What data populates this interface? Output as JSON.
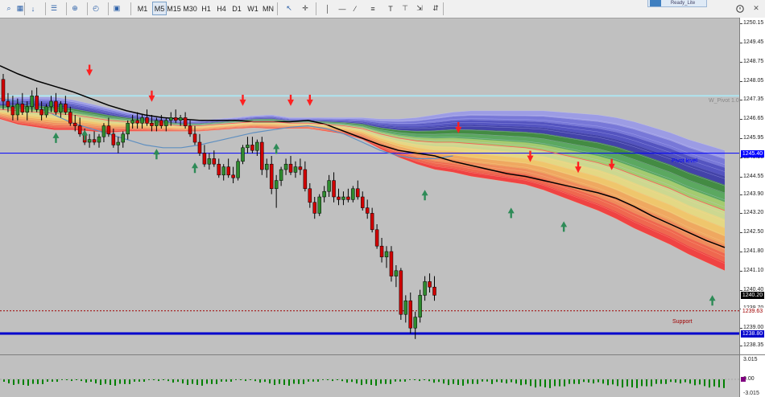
{
  "toolbar": {
    "timeframes": [
      "M1",
      "M5",
      "M15",
      "M30",
      "H1",
      "H4",
      "D1",
      "W1",
      "MN"
    ],
    "active_timeframe": "M5",
    "icons": [
      "zoom-in-icon",
      "crosshair-tools-icon",
      "arrow-down-icon",
      "properties-icon",
      "chart-type-icon",
      "add-indicator-icon",
      "clock-icon",
      "templates-icon",
      "cursor-icon",
      "crosshair-icon",
      "vertical-line-icon",
      "horizontal-line-icon",
      "trend-line-icon",
      "fibonacci-icon",
      "text-icon",
      "label-icon",
      "arrows-icon"
    ],
    "badge_text": "Ready_Lite",
    "help_icon": "help-icon"
  },
  "price_axis": {
    "ticks": [
      "1250.15",
      "1249.45",
      "1248.75",
      "1248.05",
      "1247.35",
      "1246.65",
      "1245.95",
      "1245.25",
      "1244.55",
      "1243.90",
      "1243.20",
      "1242.50",
      "1241.80",
      "1241.10",
      "1240.40",
      "1239.70",
      "1239.00",
      "1238.35"
    ],
    "current_price": "1240.20",
    "tags": [
      {
        "label": "1245.40",
        "color": "#0000ff",
        "text_color": "#ffffff"
      },
      {
        "label": "1240.20",
        "color": "#000000",
        "text_color": "#ffffff"
      },
      {
        "label": "1239.63",
        "color": "#ffffff",
        "text_color": "#a00000"
      },
      {
        "label": "1238.80",
        "color": "#0000cc",
        "text_color": "#ffffff"
      }
    ]
  },
  "levels": {
    "weekly_pivot": {
      "label": "W_Pivot 1.0",
      "price": 1247.5,
      "color": "#aee4f0"
    },
    "pivot": {
      "label": "Pivot level",
      "price": 1245.4,
      "color": "#0000ff"
    },
    "support": {
      "label": "Support",
      "price": 1239.63,
      "color": "#a00000"
    },
    "support2": {
      "price": 1238.8,
      "color": "#0000cc"
    }
  },
  "oscillator": {
    "ticks": [
      "3.015",
      "0.00",
      "-3.015"
    ],
    "bar_color": "#008000",
    "marker_color": "#800080"
  },
  "chart_data": {
    "type": "candlestick",
    "symbol_timeframe": "M5",
    "ylim": [
      1238.3,
      1250.3
    ],
    "candles": [
      [
        1248.1,
        1248.3,
        1247.0,
        1247.3
      ],
      [
        1247.3,
        1247.6,
        1246.9,
        1247.1
      ],
      [
        1247.1,
        1247.5,
        1246.6,
        1246.8
      ],
      [
        1246.8,
        1247.4,
        1246.6,
        1247.2
      ],
      [
        1247.2,
        1247.6,
        1246.8,
        1246.9
      ],
      [
        1246.9,
        1247.3,
        1246.6,
        1247.1
      ],
      [
        1247.1,
        1247.7,
        1246.9,
        1247.5
      ],
      [
        1247.5,
        1247.8,
        1246.9,
        1247.0
      ],
      [
        1247.0,
        1247.3,
        1246.6,
        1246.8
      ],
      [
        1246.8,
        1247.2,
        1246.7,
        1247.1
      ],
      [
        1247.1,
        1247.5,
        1246.9,
        1247.3
      ],
      [
        1247.3,
        1247.6,
        1246.8,
        1246.9
      ],
      [
        1246.9,
        1247.3,
        1246.7,
        1247.2
      ],
      [
        1247.2,
        1247.5,
        1246.8,
        1246.9
      ],
      [
        1246.9,
        1247.1,
        1246.4,
        1246.5
      ],
      [
        1246.5,
        1246.8,
        1246.2,
        1246.4
      ],
      [
        1246.4,
        1246.7,
        1246.0,
        1246.1
      ],
      [
        1246.1,
        1246.3,
        1245.7,
        1245.8
      ],
      [
        1245.8,
        1246.1,
        1245.6,
        1245.9
      ],
      [
        1245.9,
        1246.2,
        1245.7,
        1245.8
      ],
      [
        1245.8,
        1246.1,
        1245.6,
        1246.0
      ],
      [
        1246.0,
        1246.5,
        1245.8,
        1246.4
      ],
      [
        1246.4,
        1246.7,
        1246.0,
        1246.1
      ],
      [
        1246.1,
        1246.3,
        1245.6,
        1245.7
      ],
      [
        1245.7,
        1246.0,
        1245.4,
        1245.8
      ],
      [
        1245.8,
        1246.2,
        1245.6,
        1246.1
      ],
      [
        1246.1,
        1246.6,
        1245.9,
        1246.5
      ],
      [
        1246.5,
        1246.8,
        1246.3,
        1246.6
      ],
      [
        1246.6,
        1246.9,
        1246.3,
        1246.5
      ],
      [
        1246.5,
        1246.8,
        1246.3,
        1246.7
      ],
      [
        1246.7,
        1247.0,
        1246.4,
        1246.5
      ],
      [
        1246.5,
        1246.8,
        1246.2,
        1246.4
      ],
      [
        1246.4,
        1246.7,
        1246.2,
        1246.6
      ],
      [
        1246.6,
        1246.8,
        1246.3,
        1246.4
      ],
      [
        1246.4,
        1246.7,
        1246.2,
        1246.6
      ],
      [
        1246.6,
        1246.9,
        1246.4,
        1246.7
      ],
      [
        1246.7,
        1247.0,
        1246.5,
        1246.6
      ],
      [
        1246.6,
        1246.8,
        1246.4,
        1246.7
      ],
      [
        1246.7,
        1246.9,
        1246.3,
        1246.4
      ],
      [
        1246.4,
        1246.6,
        1246.0,
        1246.1
      ],
      [
        1246.1,
        1246.4,
        1245.7,
        1245.8
      ],
      [
        1245.8,
        1246.1,
        1245.3,
        1245.4
      ],
      [
        1245.4,
        1245.7,
        1244.9,
        1245.0
      ],
      [
        1245.0,
        1245.4,
        1244.8,
        1245.2
      ],
      [
        1245.2,
        1245.5,
        1244.9,
        1245.0
      ],
      [
        1245.0,
        1245.2,
        1244.5,
        1244.6
      ],
      [
        1244.6,
        1245.0,
        1244.4,
        1244.9
      ],
      [
        1244.9,
        1245.2,
        1244.5,
        1244.6
      ],
      [
        1244.6,
        1244.9,
        1244.3,
        1244.5
      ],
      [
        1244.5,
        1245.2,
        1244.4,
        1245.1
      ],
      [
        1245.1,
        1245.7,
        1245.0,
        1245.6
      ],
      [
        1245.6,
        1246.0,
        1245.4,
        1245.7
      ],
      [
        1245.7,
        1246.0,
        1245.4,
        1245.5
      ],
      [
        1245.5,
        1245.9,
        1245.3,
        1245.8
      ],
      [
        1245.8,
        1246.0,
        1244.6,
        1244.8
      ],
      [
        1244.8,
        1245.2,
        1244.5,
        1245.0
      ],
      [
        1245.0,
        1245.3,
        1243.9,
        1244.1
      ],
      [
        1244.1,
        1244.6,
        1243.4,
        1244.4
      ],
      [
        1244.4,
        1244.9,
        1244.2,
        1244.8
      ],
      [
        1244.8,
        1245.2,
        1244.6,
        1245.0
      ],
      [
        1245.0,
        1245.3,
        1244.6,
        1244.7
      ],
      [
        1244.7,
        1245.1,
        1244.5,
        1244.9
      ],
      [
        1244.9,
        1245.2,
        1244.6,
        1244.8
      ],
      [
        1244.8,
        1245.1,
        1244.0,
        1244.1
      ],
      [
        1244.1,
        1244.3,
        1243.4,
        1243.6
      ],
      [
        1243.6,
        1243.8,
        1243.0,
        1243.2
      ],
      [
        1243.2,
        1243.9,
        1243.1,
        1243.8
      ],
      [
        1243.8,
        1244.2,
        1243.6,
        1244.0
      ],
      [
        1244.0,
        1244.6,
        1243.8,
        1244.4
      ],
      [
        1244.4,
        1244.7,
        1243.6,
        1243.8
      ],
      [
        1243.8,
        1244.1,
        1243.5,
        1243.7
      ],
      [
        1243.7,
        1244.0,
        1243.5,
        1243.8
      ],
      [
        1243.8,
        1244.1,
        1243.6,
        1243.7
      ],
      [
        1243.7,
        1244.2,
        1243.6,
        1244.1
      ],
      [
        1244.1,
        1244.4,
        1243.7,
        1243.8
      ],
      [
        1243.8,
        1244.0,
        1243.3,
        1243.4
      ],
      [
        1243.4,
        1243.7,
        1243.0,
        1243.2
      ],
      [
        1243.2,
        1243.4,
        1242.5,
        1242.6
      ],
      [
        1242.6,
        1242.8,
        1241.9,
        1242.0
      ],
      [
        1242.0,
        1242.3,
        1241.4,
        1241.6
      ],
      [
        1241.6,
        1242.0,
        1241.2,
        1241.8
      ],
      [
        1241.8,
        1242.0,
        1240.7,
        1240.9
      ],
      [
        1240.9,
        1241.3,
        1240.5,
        1241.1
      ],
      [
        1241.1,
        1241.2,
        1239.3,
        1239.5
      ],
      [
        1239.5,
        1240.2,
        1239.2,
        1240.0
      ],
      [
        1240.0,
        1240.3,
        1238.8,
        1239.0
      ],
      [
        1239.0,
        1239.6,
        1238.6,
        1239.4
      ],
      [
        1239.4,
        1240.4,
        1239.2,
        1240.2
      ],
      [
        1240.2,
        1240.9,
        1240.0,
        1240.7
      ],
      [
        1240.7,
        1241.0,
        1240.3,
        1240.5
      ],
      [
        1240.5,
        1240.9,
        1240.0,
        1240.2
      ]
    ],
    "ribbon_center": [
      1247.0,
      1246.95,
      1246.9,
      1246.85,
      1246.8,
      1246.7,
      1246.6,
      1246.55,
      1246.5,
      1246.45,
      1246.4,
      1246.4,
      1246.45,
      1246.5,
      1246.55,
      1246.55,
      1246.5,
      1246.5,
      1246.45,
      1246.4,
      1246.3,
      1246.1,
      1245.95,
      1245.85,
      1245.8,
      1245.8,
      1245.75,
      1245.7,
      1245.65,
      1245.6,
      1245.5,
      1245.35,
      1245.2,
      1245.05,
      1244.85,
      1244.6,
      1244.35,
      1244.1,
      1243.8,
      1243.55,
      1243.3
    ],
    "ribbon_spread": [
      0.35,
      0.5,
      0.55,
      0.6,
      0.55,
      0.5,
      0.45,
      0.35,
      0.3,
      0.25,
      0.2,
      0.2,
      0.2,
      0.2,
      0.22,
      0.25,
      0.2,
      0.2,
      0.25,
      0.3,
      0.4,
      0.55,
      0.7,
      0.85,
      1.0,
      1.1,
      1.2,
      1.25,
      1.3,
      1.35,
      1.45,
      1.55,
      1.65,
      1.75,
      1.85,
      1.95,
      2.0,
      2.05,
      2.1,
      2.15,
      2.2
    ],
    "black_ma": [
      1248.6,
      1248.3,
      1248.05,
      1247.85,
      1247.65,
      1247.4,
      1247.15,
      1246.95,
      1246.8,
      1246.7,
      1246.65,
      1246.6,
      1246.6,
      1246.6,
      1246.55,
      1246.55,
      1246.55,
      1246.6,
      1246.45,
      1246.2,
      1245.95,
      1245.7,
      1245.5,
      1245.4,
      1245.3,
      1245.1,
      1244.95,
      1244.8,
      1244.65,
      1244.55,
      1244.4,
      1244.25,
      1244.1,
      1243.95,
      1243.75,
      1243.45,
      1243.1,
      1242.8,
      1242.5,
      1242.2,
      1241.95
    ],
    "blue_ma": [
      1247.4,
      1247.3,
      1247.1,
      1246.8,
      1246.5,
      1246.3,
      1246.1,
      1245.9,
      1245.7,
      1245.6,
      1245.6,
      1245.7,
      1245.85,
      1246.0,
      1246.15,
      1246.25,
      1246.35,
      1246.4,
      1246.3,
      1246.1,
      1245.8,
      1245.5,
      1245.3,
      1245.2,
      1245.2,
      1245.3
    ],
    "arrows_down": [
      [
        18,
        1248.05
      ],
      [
        31,
        1247.1
      ],
      [
        50,
        1246.95
      ],
      [
        60,
        1246.95
      ],
      [
        64,
        1246.95
      ],
      [
        95,
        1245.95
      ],
      [
        110,
        1244.9
      ],
      [
        120,
        1244.5
      ],
      [
        127,
        1244.6
      ]
    ],
    "arrows_up": [
      [
        11,
        1246.45
      ],
      [
        17,
        1246.55
      ],
      [
        32,
        1245.85
      ],
      [
        40,
        1245.35
      ],
      [
        57,
        1246.05
      ],
      [
        88,
        1244.35
      ],
      [
        106,
        1243.7
      ],
      [
        117,
        1243.2
      ],
      [
        148,
        1240.5
      ]
    ]
  }
}
